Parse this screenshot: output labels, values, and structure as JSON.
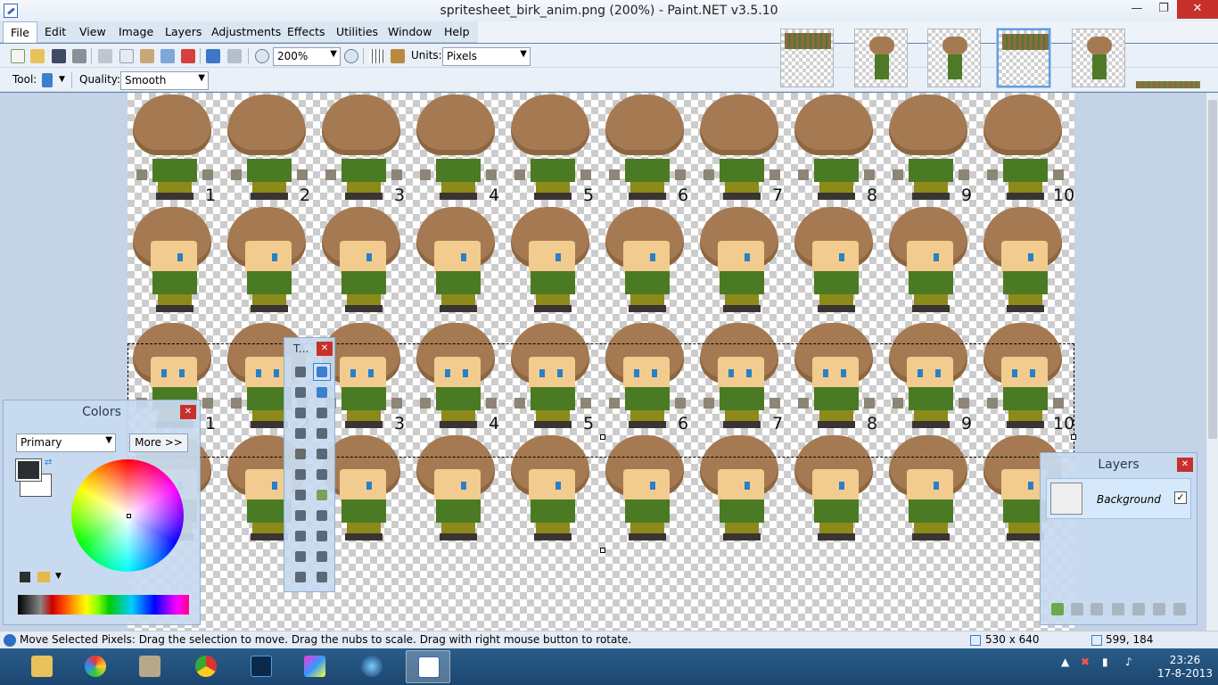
{
  "window": {
    "title": "spritesheet_birk_anim.png (200%) - Paint.NET v3.5.10",
    "min_symbol": "—",
    "max_symbol": "❐",
    "close_symbol": "✕"
  },
  "menu": [
    "File",
    "Edit",
    "View",
    "Image",
    "Layers",
    "Adjustments",
    "Effects",
    "Utilities",
    "Window",
    "Help"
  ],
  "toolbar": {
    "zoom_value": "200%",
    "units_label": "Units:",
    "units_value": "Pixels",
    "tool_label": "Tool:",
    "quality_label": "Quality:",
    "quality_value": "Smooth"
  },
  "canvas": {
    "frame_numbers": [
      "1",
      "2",
      "3",
      "4",
      "5",
      "6",
      "7",
      "8",
      "9",
      "10"
    ]
  },
  "colors_panel": {
    "title": "Colors",
    "mode_value": "Primary",
    "more_button": "More >>",
    "primary_color": "#2b2f33",
    "secondary_color": "#ffffff"
  },
  "tools_panel": {
    "title": "T..."
  },
  "layers_panel": {
    "title": "Layers",
    "layers": [
      {
        "name": "Background",
        "visible": true
      }
    ]
  },
  "status": {
    "message": "Move Selected Pixels: Drag the selection to move. Drag the nubs to scale. Drag with right mouse button to rotate.",
    "image_size": "530 x 640",
    "cursor_pos": "599, 184"
  },
  "taskbar": {
    "time": "23:26",
    "date": "17-8-2013"
  },
  "icons": [
    "app-icon",
    "new-icon",
    "open-icon",
    "save-icon",
    "print-icon",
    "cut-icon",
    "copy-icon",
    "paste-icon",
    "crop-icon",
    "deselect-icon",
    "undo-icon",
    "redo-icon",
    "zoom-out-icon",
    "zoom-in-icon",
    "grid-icon",
    "ruler-icon",
    "move-selection-icon"
  ]
}
